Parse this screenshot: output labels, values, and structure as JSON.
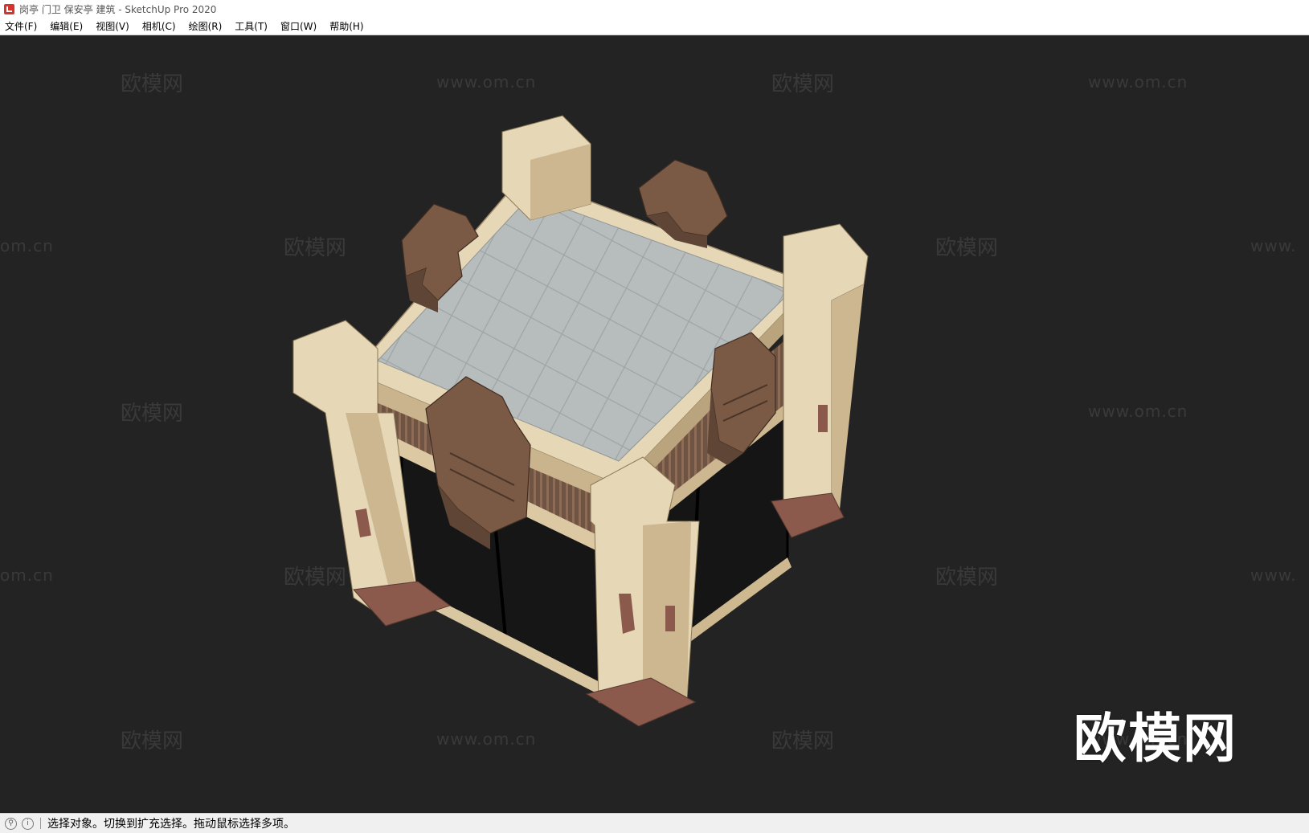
{
  "window": {
    "title": "岗亭 门卫 保安亭 建筑 - SketchUp Pro 2020"
  },
  "menu": {
    "items": [
      {
        "label": "文件(F)"
      },
      {
        "label": "编辑(E)"
      },
      {
        "label": "视图(V)"
      },
      {
        "label": "相机(C)"
      },
      {
        "label": "绘图(R)"
      },
      {
        "label": "工具(T)"
      },
      {
        "label": "窗口(W)"
      },
      {
        "label": "帮助(H)"
      }
    ]
  },
  "watermark": {
    "brand": "欧模网",
    "url": "www.om.cn",
    "url_partial_left": "om.cn",
    "url_partial_right": "www."
  },
  "logo": {
    "text": "欧模网"
  },
  "status": {
    "message": "选择对象。切换到扩充选择。拖动鼠标选择多项。"
  },
  "colors": {
    "viewport_bg": "#232323",
    "stone": "#e6d7b6",
    "stone_dark": "#c9b48d",
    "wood": "#7a5a45",
    "roof": "#b7bcbd"
  }
}
